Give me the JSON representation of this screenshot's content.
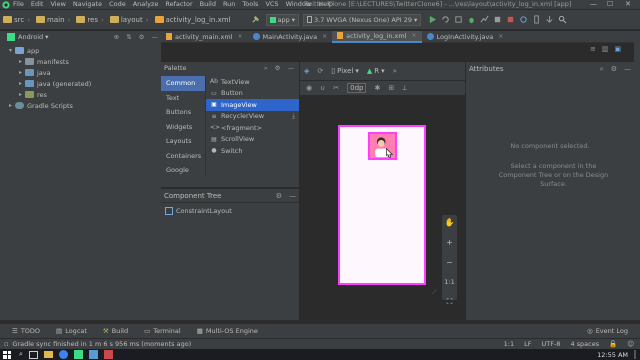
{
  "menubar": {
    "items": [
      "File",
      "Edit",
      "View",
      "Navigate",
      "Code",
      "Analyze",
      "Refactor",
      "Build",
      "Run",
      "Tools",
      "VCS",
      "Window",
      "Help"
    ],
    "title": "Twitter Clone [E:\\LECTURES\\TwitterClone6] - ...\\res\\layout\\activity_log_in.xml [app]",
    "minimize": "—",
    "maximize": "☐",
    "close": "✕"
  },
  "navbar": {
    "crumbs": [
      "src",
      "main",
      "res",
      "layout",
      "activity_log_in.xml"
    ],
    "module_combo": "app",
    "device_combo": "3.7  WVGA (Nexus One) API 29"
  },
  "project": {
    "view_selector": "Android",
    "tree": [
      {
        "label": "app",
        "level": 0,
        "expanded": true,
        "kind": "app"
      },
      {
        "label": "manifests",
        "level": 1,
        "expanded": false,
        "kind": "folder"
      },
      {
        "label": "java",
        "level": 1,
        "expanded": false,
        "kind": "java"
      },
      {
        "label": "java (generated)",
        "level": 1,
        "expanded": false,
        "kind": "java"
      },
      {
        "label": "res",
        "level": 1,
        "expanded": false,
        "kind": "res"
      },
      {
        "label": "Gradle Scripts",
        "level": 0,
        "expanded": false,
        "kind": "gradle"
      }
    ]
  },
  "tabs": [
    {
      "label": "activity_main.xml",
      "active": false
    },
    {
      "label": "MainActivity.java",
      "active": false
    },
    {
      "label": "activity_log_in.xml",
      "active": true
    },
    {
      "label": "LogInActivity.java",
      "active": false
    }
  ],
  "palette": {
    "title": "Palette",
    "categories": [
      "Common",
      "Text",
      "Buttons",
      "Widgets",
      "Layouts",
      "Containers",
      "Google"
    ],
    "active_category": "Common",
    "widgets": [
      {
        "icon": "Ab",
        "label": "TextView",
        "active": false
      },
      {
        "icon": "▭",
        "label": "Button",
        "active": false
      },
      {
        "icon": "▣",
        "label": "ImageView",
        "active": true
      },
      {
        "icon": "≡",
        "label": "RecyclerView",
        "active": false
      },
      {
        "icon": "<>",
        "label": "<fragment>",
        "active": false
      },
      {
        "icon": "▤",
        "label": "ScrollView",
        "active": false
      },
      {
        "icon": "●",
        "label": "Switch",
        "active": false
      }
    ]
  },
  "component_tree": {
    "title": "Component Tree",
    "root": "ConstraintLayout"
  },
  "design_toolbar": {
    "device": "Pixel",
    "api": "R",
    "margin": "0dp"
  },
  "zoom_controls": {
    "zoom_in": "+",
    "zoom_out": "−",
    "actual_size": "1:1"
  },
  "attributes": {
    "title": "Attributes",
    "empty_title": "No component selected.",
    "empty_hint": "Select a component in the Component Tree or on the Design Surface."
  },
  "toolwindows": {
    "left": [
      "TODO",
      "Logcat",
      "Build",
      "Terminal",
      "Multi-OS Engine"
    ],
    "right": "Event Log"
  },
  "status": {
    "message": "Gradle sync finished in 1 m 6 s 956 ms (moments ago)",
    "position": "1:1",
    "line_sep": "LF",
    "encoding": "UTF-8",
    "indent": "4 spaces"
  },
  "taskbar": {
    "time": "12:55 AM"
  },
  "colors": {
    "accent": "#4a88c7",
    "device_border": "#ff3dff",
    "selection": "#2f65ca"
  }
}
